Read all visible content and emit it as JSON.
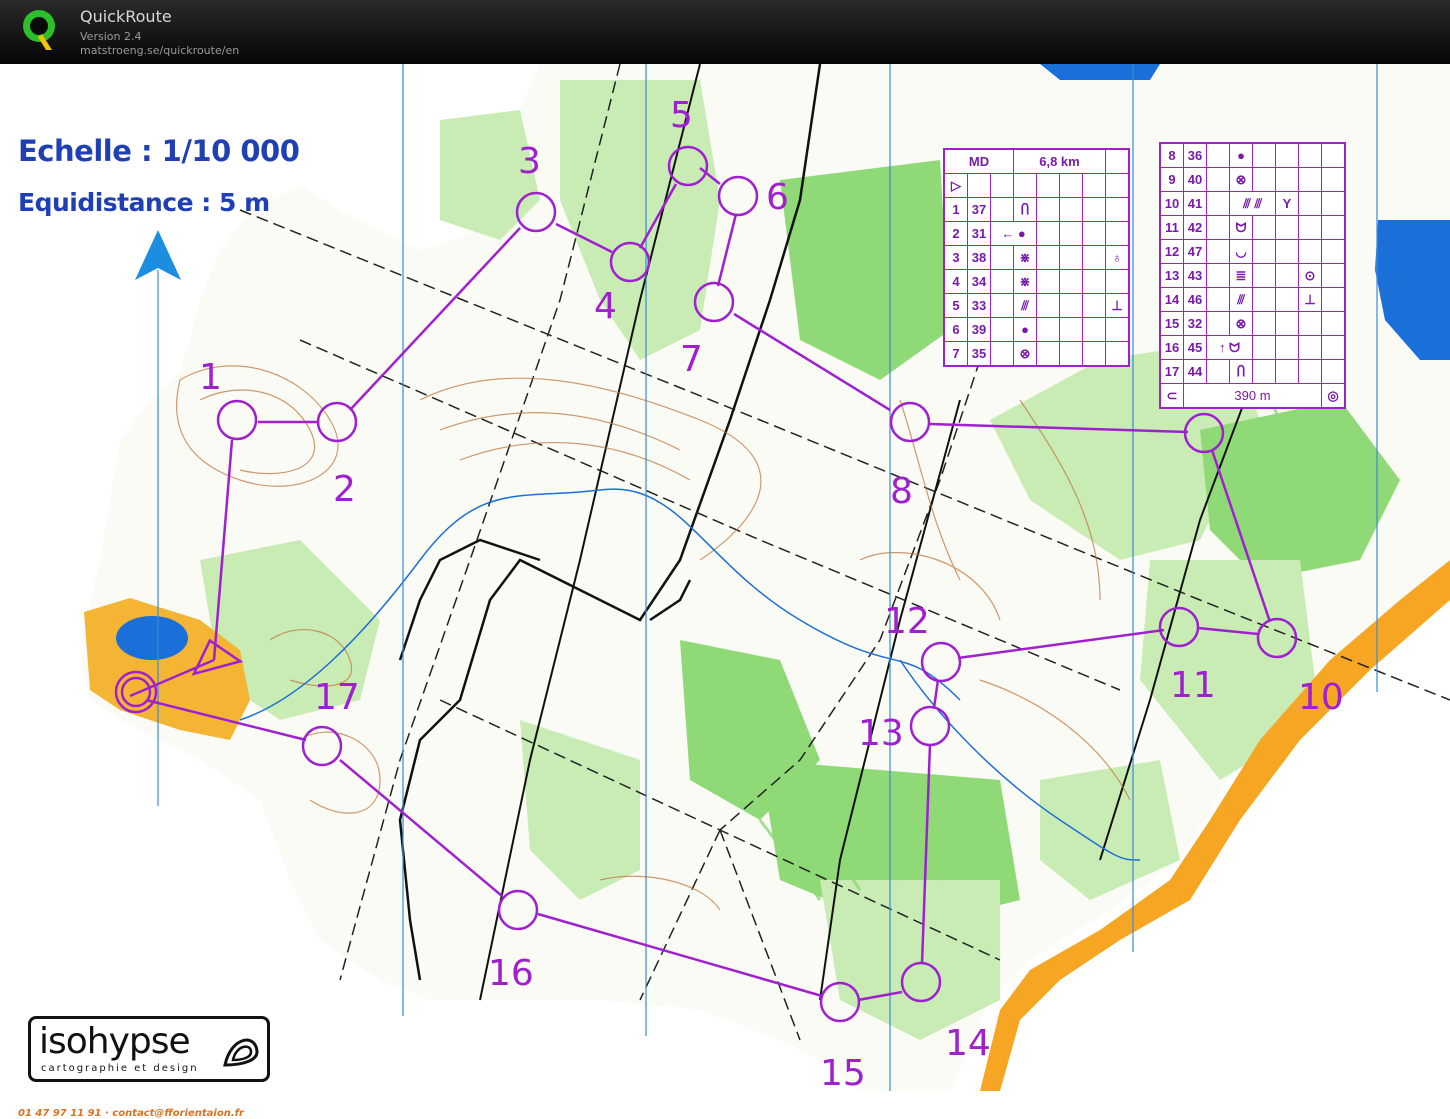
{
  "app": {
    "name": "QuickRoute",
    "version": "Version 2.4",
    "url": "matstroeng.se/quickroute/en"
  },
  "map": {
    "scale_label": "Echelle : 1/10 000",
    "equidistance_label": "Equidistance : 5 m",
    "footer_contact": "01 47 97 11 91 · contact@fforientaion.fr",
    "publisher": {
      "name": "isohypse",
      "tagline": "cartographie et design"
    }
  },
  "course": {
    "controls": [
      "1",
      "2",
      "3",
      "4",
      "5",
      "6",
      "7",
      "8",
      "9",
      "10",
      "11",
      "12",
      "13",
      "14",
      "15",
      "16",
      "17"
    ],
    "descriptions_left": {
      "header": [
        "MD",
        "6,8 km"
      ],
      "rows": [
        {
          "num": "1",
          "code": "37",
          "symbol": "Ⴖ",
          "extra": ""
        },
        {
          "num": "2",
          "code": "31",
          "symbol": "←  ●",
          "extra": ""
        },
        {
          "num": "3",
          "code": "38",
          "symbol": "⋇",
          "extra": "♁"
        },
        {
          "num": "4",
          "code": "34",
          "symbol": "⋇",
          "extra": ""
        },
        {
          "num": "5",
          "code": "33",
          "symbol": "⫻",
          "extra": "⊥"
        },
        {
          "num": "6",
          "code": "39",
          "symbol": "●",
          "extra": ""
        },
        {
          "num": "7",
          "code": "35",
          "symbol": "⊗",
          "extra": ""
        }
      ]
    },
    "descriptions_right": {
      "rows": [
        {
          "num": "8",
          "code": "36",
          "symbol": "●",
          "extra": ""
        },
        {
          "num": "9",
          "code": "40",
          "symbol": "⊗",
          "extra": ""
        },
        {
          "num": "10",
          "code": "41",
          "symbol": "⫻ ⫻",
          "extra": "Y"
        },
        {
          "num": "11",
          "code": "42",
          "symbol": "ᗢ",
          "extra": ""
        },
        {
          "num": "12",
          "code": "47",
          "symbol": "◡",
          "extra": ""
        },
        {
          "num": "13",
          "code": "43",
          "symbol": "≣",
          "extra": "⊙"
        },
        {
          "num": "14",
          "code": "46",
          "symbol": "⫻",
          "extra": "⊥"
        },
        {
          "num": "15",
          "code": "32",
          "symbol": "⊗",
          "extra": ""
        },
        {
          "num": "16",
          "code": "45",
          "symbol": "↑  ᗢ",
          "extra": ""
        },
        {
          "num": "17",
          "code": "44",
          "symbol": "Ⴖ",
          "extra": ""
        }
      ],
      "finish_distance": "390 m"
    }
  },
  "colors": {
    "course": "#a020d0",
    "forest_green": "#8fd977",
    "light_green": "#c8ecb4",
    "contour_brown": "#c07840",
    "water_blue": "#1b6fd8",
    "yellow_open": "#f3b533",
    "north_arrow": "#1c8ee0"
  }
}
